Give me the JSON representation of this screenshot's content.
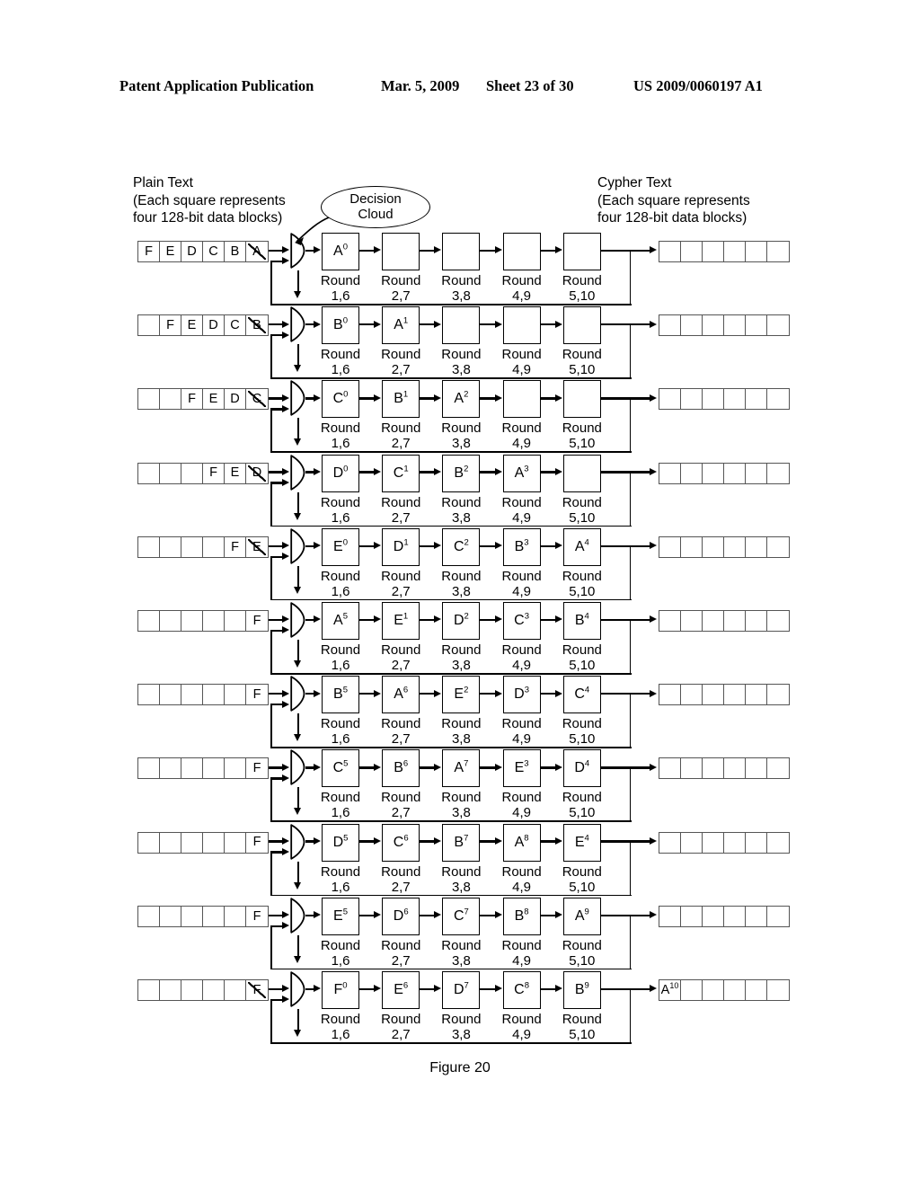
{
  "header": {
    "publication": "Patent Application Publication",
    "date": "Mar. 5, 2009",
    "sheet": "Sheet 23 of 30",
    "number": "US 2009/0060197 A1"
  },
  "figure": {
    "caption": "Figure 20",
    "plain_text_label": [
      "Plain Text",
      "(Each square represents",
      "four 128-bit data blocks)"
    ],
    "cypher_text_label": [
      "Cypher Text",
      "(Each square represents",
      "four 128-bit data blocks)"
    ],
    "decision_cloud": [
      "Decision",
      "Cloud"
    ],
    "round_labels": [
      {
        "line1": "Round",
        "line2": "1,6"
      },
      {
        "line1": "Round",
        "line2": "2,7"
      },
      {
        "line1": "Round",
        "line2": "3,8"
      },
      {
        "line1": "Round",
        "line2": "4,9"
      },
      {
        "line1": "Round",
        "line2": "5,10"
      }
    ],
    "rows": [
      {
        "input_cells": [
          {
            "text": "F",
            "struck": false
          },
          {
            "text": "E",
            "struck": false
          },
          {
            "text": "D",
            "struck": false
          },
          {
            "text": "C",
            "struck": false
          },
          {
            "text": "B",
            "struck": false
          },
          {
            "text": "A",
            "struck": true
          }
        ],
        "stages": [
          {
            "base": "A",
            "sup": "0"
          },
          {
            "base": "",
            "sup": ""
          },
          {
            "base": "",
            "sup": ""
          },
          {
            "base": "",
            "sup": ""
          },
          {
            "base": "",
            "sup": ""
          }
        ],
        "output_cells": [
          {
            "text": "",
            "struck": false
          },
          {
            "text": "",
            "struck": false
          },
          {
            "text": "",
            "struck": false
          },
          {
            "text": "",
            "struck": false
          },
          {
            "text": "",
            "struck": false
          },
          {
            "text": "",
            "struck": false
          }
        ]
      },
      {
        "input_cells": [
          {
            "text": "",
            "struck": false
          },
          {
            "text": "F",
            "struck": false
          },
          {
            "text": "E",
            "struck": false
          },
          {
            "text": "D",
            "struck": false
          },
          {
            "text": "C",
            "struck": false
          },
          {
            "text": "B",
            "struck": true
          }
        ],
        "stages": [
          {
            "base": "B",
            "sup": "0"
          },
          {
            "base": "A",
            "sup": "1"
          },
          {
            "base": "",
            "sup": ""
          },
          {
            "base": "",
            "sup": ""
          },
          {
            "base": "",
            "sup": ""
          }
        ],
        "output_cells": [
          {
            "text": "",
            "struck": false
          },
          {
            "text": "",
            "struck": false
          },
          {
            "text": "",
            "struck": false
          },
          {
            "text": "",
            "struck": false
          },
          {
            "text": "",
            "struck": false
          },
          {
            "text": "",
            "struck": false
          }
        ]
      },
      {
        "input_cells": [
          {
            "text": "",
            "struck": false
          },
          {
            "text": "",
            "struck": false
          },
          {
            "text": "F",
            "struck": false
          },
          {
            "text": "E",
            "struck": false
          },
          {
            "text": "D",
            "struck": false
          },
          {
            "text": "C",
            "struck": true
          }
        ],
        "stages": [
          {
            "base": "C",
            "sup": "0"
          },
          {
            "base": "B",
            "sup": "1"
          },
          {
            "base": "A",
            "sup": "2"
          },
          {
            "base": "",
            "sup": ""
          },
          {
            "base": "",
            "sup": ""
          }
        ],
        "output_cells": [
          {
            "text": "",
            "struck": false
          },
          {
            "text": "",
            "struck": false
          },
          {
            "text": "",
            "struck": false
          },
          {
            "text": "",
            "struck": false
          },
          {
            "text": "",
            "struck": false
          },
          {
            "text": "",
            "struck": false
          }
        ]
      },
      {
        "input_cells": [
          {
            "text": "",
            "struck": false
          },
          {
            "text": "",
            "struck": false
          },
          {
            "text": "",
            "struck": false
          },
          {
            "text": "F",
            "struck": false
          },
          {
            "text": "E",
            "struck": false
          },
          {
            "text": "D",
            "struck": true
          }
        ],
        "stages": [
          {
            "base": "D",
            "sup": "0"
          },
          {
            "base": "C",
            "sup": "1"
          },
          {
            "base": "B",
            "sup": "2"
          },
          {
            "base": "A",
            "sup": "3"
          },
          {
            "base": "",
            "sup": ""
          }
        ],
        "output_cells": [
          {
            "text": "",
            "struck": false
          },
          {
            "text": "",
            "struck": false
          },
          {
            "text": "",
            "struck": false
          },
          {
            "text": "",
            "struck": false
          },
          {
            "text": "",
            "struck": false
          },
          {
            "text": "",
            "struck": false
          }
        ]
      },
      {
        "input_cells": [
          {
            "text": "",
            "struck": false
          },
          {
            "text": "",
            "struck": false
          },
          {
            "text": "",
            "struck": false
          },
          {
            "text": "",
            "struck": false
          },
          {
            "text": "F",
            "struck": false
          },
          {
            "text": "E",
            "struck": true
          }
        ],
        "stages": [
          {
            "base": "E",
            "sup": "0"
          },
          {
            "base": "D",
            "sup": "1"
          },
          {
            "base": "C",
            "sup": "2"
          },
          {
            "base": "B",
            "sup": "3"
          },
          {
            "base": "A",
            "sup": "4"
          }
        ],
        "output_cells": [
          {
            "text": "",
            "struck": false
          },
          {
            "text": "",
            "struck": false
          },
          {
            "text": "",
            "struck": false
          },
          {
            "text": "",
            "struck": false
          },
          {
            "text": "",
            "struck": false
          },
          {
            "text": "",
            "struck": false
          }
        ]
      },
      {
        "input_cells": [
          {
            "text": "",
            "struck": false
          },
          {
            "text": "",
            "struck": false
          },
          {
            "text": "",
            "struck": false
          },
          {
            "text": "",
            "struck": false
          },
          {
            "text": "",
            "struck": false
          },
          {
            "text": "F",
            "struck": false
          }
        ],
        "stages": [
          {
            "base": "A",
            "sup": "5"
          },
          {
            "base": "E",
            "sup": "1"
          },
          {
            "base": "D",
            "sup": "2"
          },
          {
            "base": "C",
            "sup": "3"
          },
          {
            "base": "B",
            "sup": "4"
          }
        ],
        "output_cells": [
          {
            "text": "",
            "struck": false
          },
          {
            "text": "",
            "struck": false
          },
          {
            "text": "",
            "struck": false
          },
          {
            "text": "",
            "struck": false
          },
          {
            "text": "",
            "struck": false
          },
          {
            "text": "",
            "struck": false
          }
        ]
      },
      {
        "input_cells": [
          {
            "text": "",
            "struck": false
          },
          {
            "text": "",
            "struck": false
          },
          {
            "text": "",
            "struck": false
          },
          {
            "text": "",
            "struck": false
          },
          {
            "text": "",
            "struck": false
          },
          {
            "text": "F",
            "struck": false
          }
        ],
        "stages": [
          {
            "base": "B",
            "sup": "5"
          },
          {
            "base": "A",
            "sup": "6"
          },
          {
            "base": "E",
            "sup": "2"
          },
          {
            "base": "D",
            "sup": "3"
          },
          {
            "base": "C",
            "sup": "4"
          }
        ],
        "output_cells": [
          {
            "text": "",
            "struck": false
          },
          {
            "text": "",
            "struck": false
          },
          {
            "text": "",
            "struck": false
          },
          {
            "text": "",
            "struck": false
          },
          {
            "text": "",
            "struck": false
          },
          {
            "text": "",
            "struck": false
          }
        ]
      },
      {
        "input_cells": [
          {
            "text": "",
            "struck": false
          },
          {
            "text": "",
            "struck": false
          },
          {
            "text": "",
            "struck": false
          },
          {
            "text": "",
            "struck": false
          },
          {
            "text": "",
            "struck": false
          },
          {
            "text": "F",
            "struck": false
          }
        ],
        "stages": [
          {
            "base": "C",
            "sup": "5"
          },
          {
            "base": "B",
            "sup": "6"
          },
          {
            "base": "A",
            "sup": "7"
          },
          {
            "base": "E",
            "sup": "3"
          },
          {
            "base": "D",
            "sup": "4"
          }
        ],
        "output_cells": [
          {
            "text": "",
            "struck": false
          },
          {
            "text": "",
            "struck": false
          },
          {
            "text": "",
            "struck": false
          },
          {
            "text": "",
            "struck": false
          },
          {
            "text": "",
            "struck": false
          },
          {
            "text": "",
            "struck": false
          }
        ]
      },
      {
        "input_cells": [
          {
            "text": "",
            "struck": false
          },
          {
            "text": "",
            "struck": false
          },
          {
            "text": "",
            "struck": false
          },
          {
            "text": "",
            "struck": false
          },
          {
            "text": "",
            "struck": false
          },
          {
            "text": "F",
            "struck": false
          }
        ],
        "stages": [
          {
            "base": "D",
            "sup": "5"
          },
          {
            "base": "C",
            "sup": "6"
          },
          {
            "base": "B",
            "sup": "7"
          },
          {
            "base": "A",
            "sup": "8"
          },
          {
            "base": "E",
            "sup": "4"
          }
        ],
        "output_cells": [
          {
            "text": "",
            "struck": false
          },
          {
            "text": "",
            "struck": false
          },
          {
            "text": "",
            "struck": false
          },
          {
            "text": "",
            "struck": false
          },
          {
            "text": "",
            "struck": false
          },
          {
            "text": "",
            "struck": false
          }
        ]
      },
      {
        "input_cells": [
          {
            "text": "",
            "struck": false
          },
          {
            "text": "",
            "struck": false
          },
          {
            "text": "",
            "struck": false
          },
          {
            "text": "",
            "struck": false
          },
          {
            "text": "",
            "struck": false
          },
          {
            "text": "F",
            "struck": false
          }
        ],
        "stages": [
          {
            "base": "E",
            "sup": "5"
          },
          {
            "base": "D",
            "sup": "6"
          },
          {
            "base": "C",
            "sup": "7"
          },
          {
            "base": "B",
            "sup": "8"
          },
          {
            "base": "A",
            "sup": "9"
          }
        ],
        "output_cells": [
          {
            "text": "",
            "struck": false
          },
          {
            "text": "",
            "struck": false
          },
          {
            "text": "",
            "struck": false
          },
          {
            "text": "",
            "struck": false
          },
          {
            "text": "",
            "struck": false
          },
          {
            "text": "",
            "struck": false
          }
        ]
      },
      {
        "input_cells": [
          {
            "text": "",
            "struck": false
          },
          {
            "text": "",
            "struck": false
          },
          {
            "text": "",
            "struck": false
          },
          {
            "text": "",
            "struck": false
          },
          {
            "text": "",
            "struck": false
          },
          {
            "text": "F",
            "struck": true
          }
        ],
        "stages": [
          {
            "base": "F",
            "sup": "0"
          },
          {
            "base": "E",
            "sup": "6"
          },
          {
            "base": "D",
            "sup": "7"
          },
          {
            "base": "C",
            "sup": "8"
          },
          {
            "base": "B",
            "sup": "9"
          }
        ],
        "output_cells": [
          {
            "text": "A",
            "sup": "10",
            "struck": false
          },
          {
            "text": "",
            "struck": false
          },
          {
            "text": "",
            "struck": false
          },
          {
            "text": "",
            "struck": false
          },
          {
            "text": "",
            "struck": false
          },
          {
            "text": "",
            "struck": false
          }
        ]
      }
    ]
  }
}
